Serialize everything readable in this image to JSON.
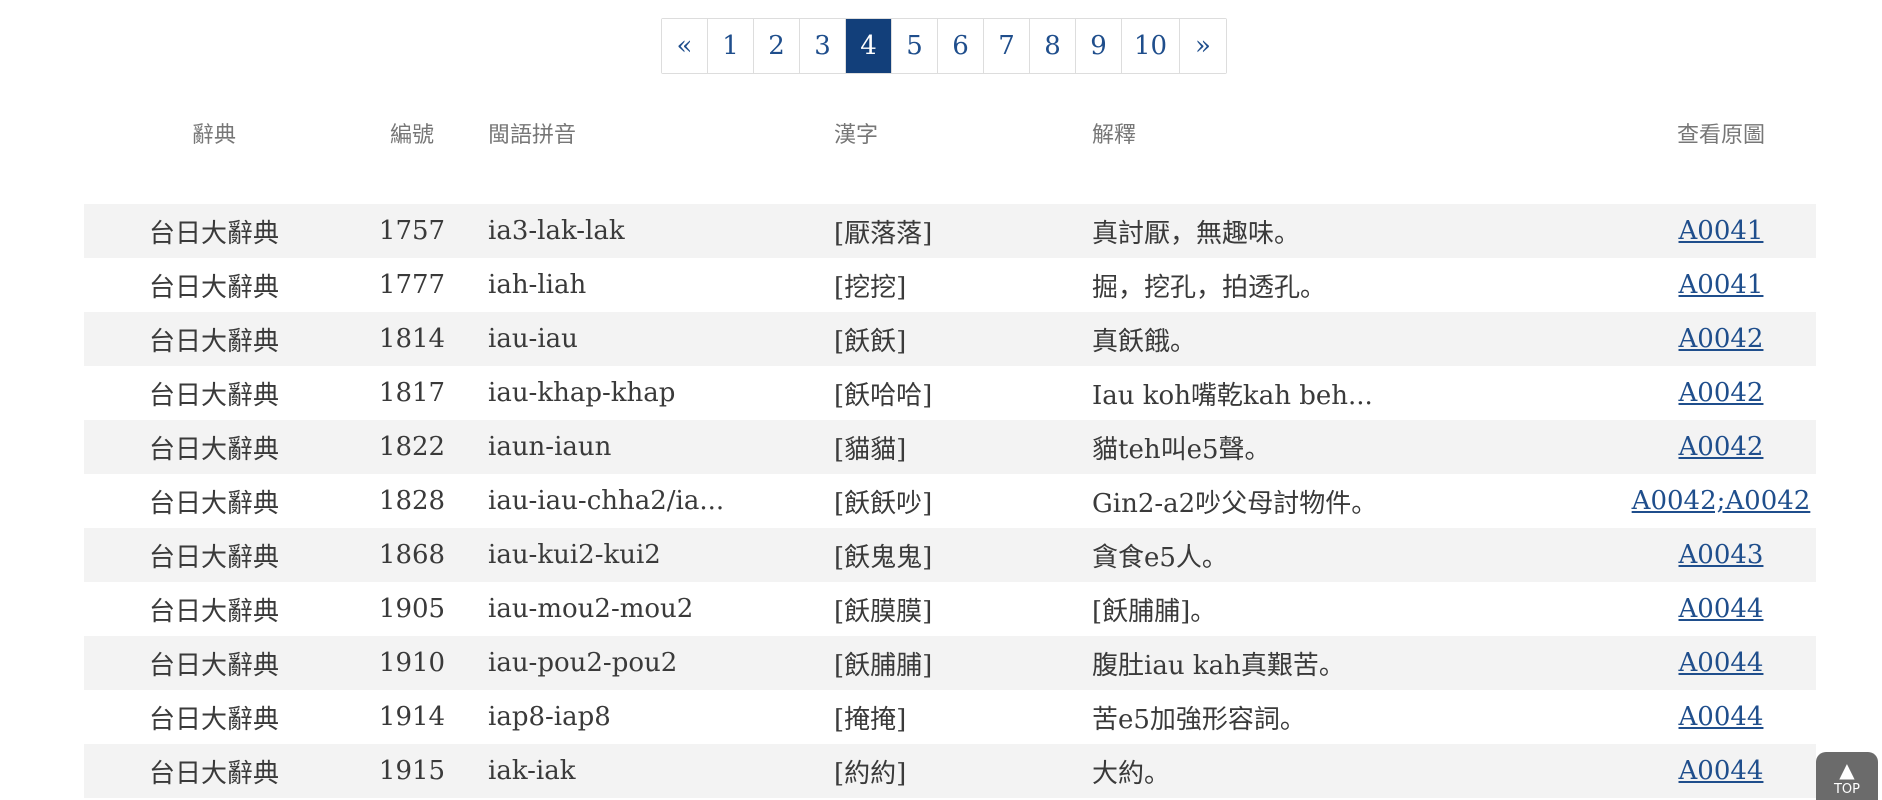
{
  "pagination": {
    "prev": "«",
    "next": "»",
    "pages": [
      "1",
      "2",
      "3",
      "4",
      "5",
      "6",
      "7",
      "8",
      "9",
      "10"
    ],
    "current": "4"
  },
  "table": {
    "headers": {
      "dictionary": "辭典",
      "number": "編號",
      "pinyin": "閩語拼音",
      "hanzi": "漢字",
      "definition": "解釋",
      "view_image": "查看原圖"
    },
    "rows": [
      {
        "dictionary": "台日大辭典",
        "number": "1757",
        "pinyin": "ia3-lak-lak",
        "hanzi": "[厭落落]",
        "definition": "真討厭，無趣味。",
        "image": "A0041"
      },
      {
        "dictionary": "台日大辭典",
        "number": "1777",
        "pinyin": "iah-liah",
        "hanzi": "[挖挖]",
        "definition": "掘，挖孔，拍透孔。",
        "image": "A0041"
      },
      {
        "dictionary": "台日大辭典",
        "number": "1814",
        "pinyin": "iau-iau",
        "hanzi": "[飫飫]",
        "definition": "真飫餓。",
        "image": "A0042"
      },
      {
        "dictionary": "台日大辭典",
        "number": "1817",
        "pinyin": "iau-khap-khap",
        "hanzi": "[飫哈哈]",
        "definition": "Iau koh嘴乾kah beh...",
        "image": "A0042"
      },
      {
        "dictionary": "台日大辭典",
        "number": "1822",
        "pinyin": "iaun-iaun",
        "hanzi": "[貓貓]",
        "definition": "貓teh叫e5聲。",
        "image": "A0042"
      },
      {
        "dictionary": "台日大辭典",
        "number": "1828",
        "pinyin": "iau-iau-chha2/ia...",
        "hanzi": "[飫飫吵]",
        "definition": "Gin2-a2吵父母討物件。",
        "image": "A0042;A0042"
      },
      {
        "dictionary": "台日大辭典",
        "number": "1868",
        "pinyin": "iau-kui2-kui2",
        "hanzi": "[飫鬼鬼]",
        "definition": "貪食e5人。",
        "image": "A0043"
      },
      {
        "dictionary": "台日大辭典",
        "number": "1905",
        "pinyin": "iau-mou2-mou2",
        "hanzi": "[飫膜膜]",
        "definition": "[飫脯脯]。",
        "image": "A0044"
      },
      {
        "dictionary": "台日大辭典",
        "number": "1910",
        "pinyin": "iau-pou2-pou2",
        "hanzi": "[飫脯脯]",
        "definition": "腹肚iau kah真艱苦。",
        "image": "A0044"
      },
      {
        "dictionary": "台日大辭典",
        "number": "1914",
        "pinyin": "iap8-iap8",
        "hanzi": "[掩掩]",
        "definition": "苦e5加強形容詞。",
        "image": "A0044"
      },
      {
        "dictionary": "台日大辭典",
        "number": "1915",
        "pinyin": "iak-iak",
        "hanzi": "[約約]",
        "definition": "大約。",
        "image": "A0044"
      }
    ]
  },
  "top_button": {
    "arrow": "▲",
    "label": "TOP"
  },
  "colors": {
    "accent": "#123f7a",
    "link": "#1f4e8c",
    "row_alt": "#f3f3f3",
    "top_button": "#6b6b6b"
  }
}
